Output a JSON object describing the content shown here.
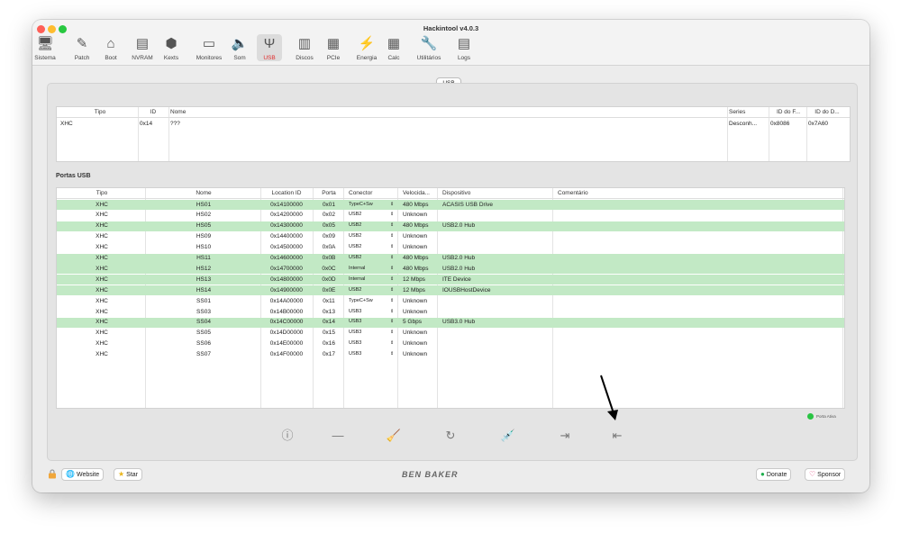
{
  "window": {
    "title": "Hackintool v4.0.3"
  },
  "toolbar": {
    "items": [
      {
        "label": "Sistema",
        "icon": "computer-icon"
      },
      {
        "label": "Patch",
        "icon": "pencil-icon"
      },
      {
        "label": "Boot",
        "icon": "boot-icon"
      },
      {
        "label": "NVRAM",
        "icon": "nvram-icon"
      },
      {
        "label": "Kexts",
        "icon": "kexts-icon"
      },
      {
        "label": "Monitores",
        "icon": "monitor-icon"
      },
      {
        "label": "Som",
        "icon": "speaker-icon"
      },
      {
        "label": "USB",
        "icon": "usb-icon",
        "active": true
      },
      {
        "label": "Discos",
        "icon": "disk-icon"
      },
      {
        "label": "PCIe",
        "icon": "pcie-icon"
      },
      {
        "label": "Energia",
        "icon": "power-icon"
      },
      {
        "label": "Calc",
        "icon": "calculator-icon"
      },
      {
        "label": "Utilitários",
        "icon": "wrench-icon"
      },
      {
        "label": "Logs",
        "icon": "logs-icon"
      }
    ]
  },
  "tab": {
    "label": "USB"
  },
  "controllers": {
    "headers": [
      "Tipo",
      "ID",
      "Nome",
      "Series",
      "ID do F...",
      "ID do D..."
    ],
    "rows": [
      {
        "tipo": "XHC",
        "id": "0x14",
        "nome": "???",
        "series": "Desconh...",
        "vendor": "0x8086",
        "device": "0x7A60"
      }
    ]
  },
  "ports": {
    "title": "Portas USB",
    "headers": [
      "Tipo",
      "Nome",
      "Location ID",
      "Porta",
      "Conector",
      "Velocida...",
      "Dispositivo",
      "Comentário"
    ],
    "rows": [
      {
        "tipo": "XHC",
        "nome": "HS01",
        "loc": "0x14100000",
        "porta": "0x01",
        "conector": "TypeC+Sw",
        "vel": "480 Mbps",
        "disp": "ACASIS USB Drive",
        "active": true
      },
      {
        "tipo": "XHC",
        "nome": "HS02",
        "loc": "0x14200000",
        "porta": "0x02",
        "conector": "USB2",
        "vel": "Unknown",
        "disp": "",
        "active": false
      },
      {
        "tipo": "XHC",
        "nome": "HS05",
        "loc": "0x14300000",
        "porta": "0x05",
        "conector": "USB2",
        "vel": "480 Mbps",
        "disp": "USB2.0 Hub",
        "active": true
      },
      {
        "tipo": "XHC",
        "nome": "HS09",
        "loc": "0x14400000",
        "porta": "0x09",
        "conector": "USB2",
        "vel": "Unknown",
        "disp": "",
        "active": false
      },
      {
        "tipo": "XHC",
        "nome": "HS10",
        "loc": "0x14500000",
        "porta": "0x0A",
        "conector": "USB2",
        "vel": "Unknown",
        "disp": "",
        "active": false
      },
      {
        "tipo": "XHC",
        "nome": "HS11",
        "loc": "0x14600000",
        "porta": "0x0B",
        "conector": "USB2",
        "vel": "480 Mbps",
        "disp": "USB2.0 Hub",
        "active": true
      },
      {
        "tipo": "XHC",
        "nome": "HS12",
        "loc": "0x14700000",
        "porta": "0x0C",
        "conector": "Internal",
        "vel": "480 Mbps",
        "disp": "USB2.0 Hub",
        "active": true
      },
      {
        "tipo": "XHC",
        "nome": "HS13",
        "loc": "0x14800000",
        "porta": "0x0D",
        "conector": "Internal",
        "vel": "12 Mbps",
        "disp": "ITE Device",
        "active": true
      },
      {
        "tipo": "XHC",
        "nome": "HS14",
        "loc": "0x14900000",
        "porta": "0x0E",
        "conector": "USB2",
        "vel": "12 Mbps",
        "disp": "IOUSBHostDevice",
        "active": true
      },
      {
        "tipo": "XHC",
        "nome": "SS01",
        "loc": "0x14A00000",
        "porta": "0x11",
        "conector": "TypeC+Sw",
        "vel": "Unknown",
        "disp": "",
        "active": false
      },
      {
        "tipo": "XHC",
        "nome": "SS03",
        "loc": "0x14B00000",
        "porta": "0x13",
        "conector": "USB3",
        "vel": "Unknown",
        "disp": "",
        "active": false
      },
      {
        "tipo": "XHC",
        "nome": "SS04",
        "loc": "0x14C00000",
        "porta": "0x14",
        "conector": "USB3",
        "vel": "5 Gbps",
        "disp": "USB3.0 Hub",
        "active": true
      },
      {
        "tipo": "XHC",
        "nome": "SS05",
        "loc": "0x14D00000",
        "porta": "0x15",
        "conector": "USB3",
        "vel": "Unknown",
        "disp": "",
        "active": false
      },
      {
        "tipo": "XHC",
        "nome": "SS06",
        "loc": "0x14E00000",
        "porta": "0x16",
        "conector": "USB3",
        "vel": "Unknown",
        "disp": "",
        "active": false
      },
      {
        "tipo": "XHC",
        "nome": "SS07",
        "loc": "0x14F00000",
        "porta": "0x17",
        "conector": "USB3",
        "vel": "Unknown",
        "disp": "",
        "active": false
      }
    ]
  },
  "legend": {
    "label": "Porta Ativa",
    "color": "#29c443"
  },
  "actions": [
    {
      "name": "info-button",
      "icon": "info-icon",
      "glyph": "ⓘ"
    },
    {
      "name": "remove-button",
      "icon": "minus-icon",
      "glyph": "—"
    },
    {
      "name": "clear-button",
      "icon": "broom-icon",
      "glyph": "🧹"
    },
    {
      "name": "refresh-button",
      "icon": "refresh-icon",
      "glyph": "↻"
    },
    {
      "name": "inject-button",
      "icon": "syringe-icon",
      "glyph": "💉"
    },
    {
      "name": "import-button",
      "icon": "import-icon",
      "glyph": "⇥"
    },
    {
      "name": "export-button",
      "icon": "export-icon",
      "glyph": "⇤"
    }
  ],
  "footer": {
    "website_label": "Website",
    "star_label": "Star",
    "logo": "BEN BAKER",
    "donate_label": "Donate",
    "sponsor_label": "Sponsor"
  },
  "colors": {
    "active_row": "#c2e9c5",
    "active_tab_label": "#e02a2a",
    "arrow": "#000000"
  }
}
